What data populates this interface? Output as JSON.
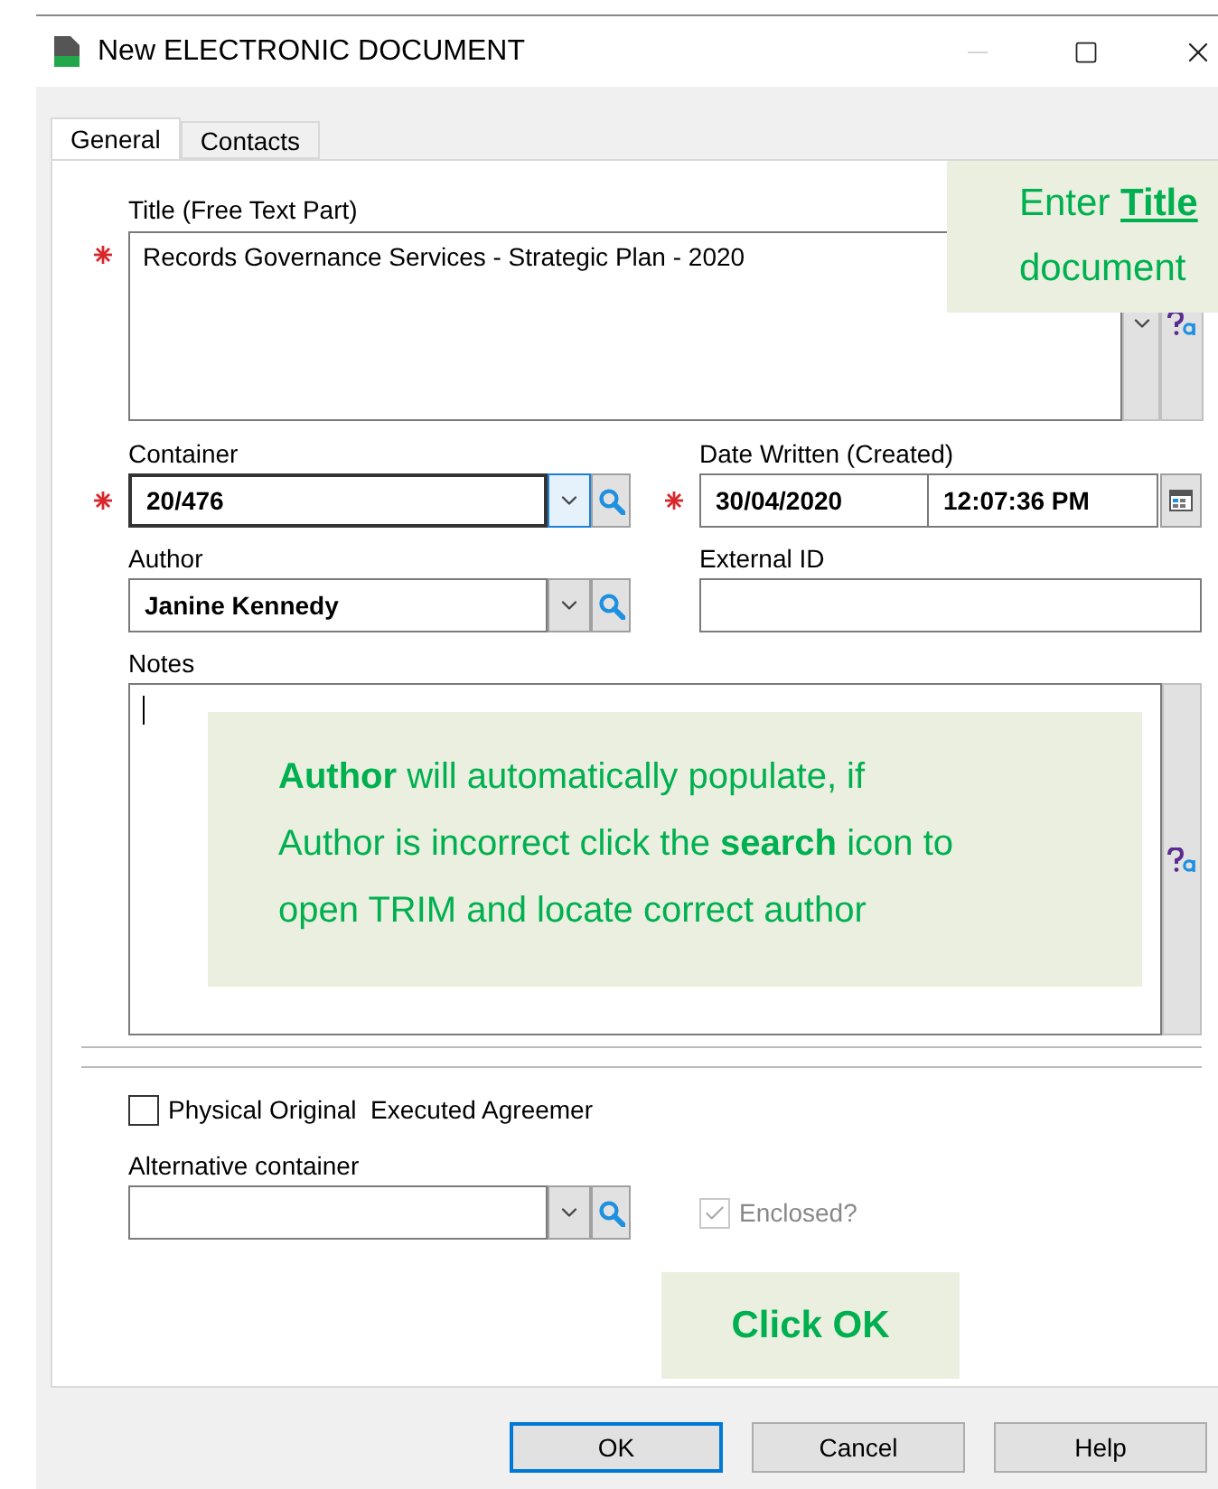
{
  "window": {
    "title": "New ELECTRONIC DOCUMENT"
  },
  "tabs": [
    {
      "label": "General",
      "selected": true
    },
    {
      "label": "Contacts",
      "selected": false
    }
  ],
  "title_field": {
    "label": "Title (Free Text Part)",
    "value": "Records Governance Services - Strategic Plan - 2020",
    "required": true
  },
  "container": {
    "label": "Container",
    "value": "20/476",
    "required": true,
    "focused": true
  },
  "date_written": {
    "label": "Date Written (Created)",
    "date": "30/04/2020",
    "time": "12:07:36 PM",
    "required": true
  },
  "author": {
    "label": "Author",
    "value": "Janine Kennedy",
    "required": false,
    "focused": false
  },
  "external_id": {
    "label": "External ID"
  },
  "notes": {
    "label": "Notes"
  },
  "physical_original": {
    "label": "Physical Original  Executed Agreemer",
    "checked": false
  },
  "alternative_container": {
    "label": "Alternative container",
    "required": false,
    "focused": false
  },
  "enclosed": {
    "label": "Enclosed?",
    "checked": true,
    "disabled": true
  },
  "title_callout": {
    "lines": [
      "Enter **Title**",
      "document"
    ]
  },
  "author_callout": {
    "lines": [
      "**Author** will automatically populate, if",
      "Author is incorrect click the **search** icon to",
      "open TRIM and locate correct author"
    ]
  },
  "ok_callout": {
    "text": "Click OK"
  },
  "buttons": [
    {
      "label": "OK",
      "default": true
    },
    {
      "label": "Cancel",
      "default": false
    },
    {
      "label": "Help",
      "default": false
    }
  ]
}
